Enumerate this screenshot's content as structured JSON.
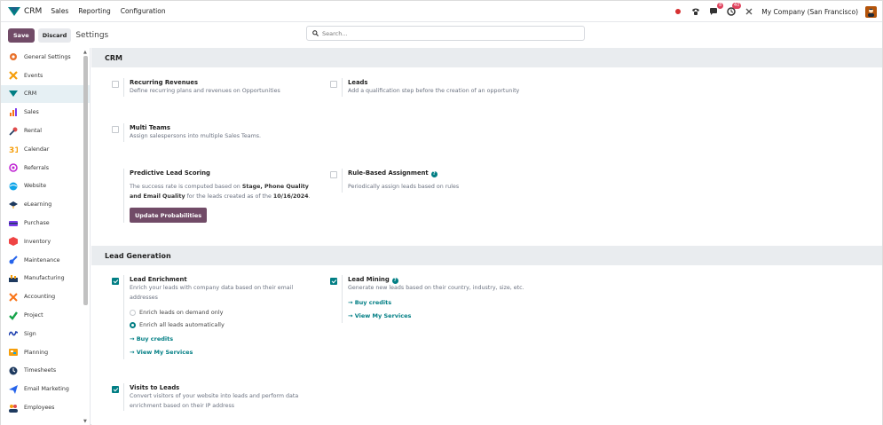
{
  "navbar": {
    "app_name": "CRM",
    "menus": [
      "Sales",
      "Reporting",
      "Configuration"
    ],
    "company": "My Company (San Francisco)",
    "chat_badge": "8",
    "activity_badge": "40",
    "accent": "#714b67"
  },
  "control_panel": {
    "save_label": "Save",
    "discard_label": "Discard",
    "title": "Settings",
    "search_placeholder": "Search..."
  },
  "sidebar": {
    "items": [
      {
        "label": "General Settings",
        "icon": "gear-icon",
        "color": "#e8702a"
      },
      {
        "label": "Events",
        "icon": "events-icon",
        "color": "#f59e0b"
      },
      {
        "label": "CRM",
        "icon": "crm-icon",
        "color": "#017e84"
      },
      {
        "label": "Sales",
        "icon": "sales-icon",
        "color": "#f97316"
      },
      {
        "label": "Rental",
        "icon": "rental-icon",
        "color": "#e14b4b"
      },
      {
        "label": "Calendar",
        "icon": "calendar-icon",
        "color": "#f59e0b"
      },
      {
        "label": "Referrals",
        "icon": "referrals-icon",
        "color": "#c026d3"
      },
      {
        "label": "Website",
        "icon": "website-icon",
        "color": "#0ea5e9"
      },
      {
        "label": "eLearning",
        "icon": "elearning-icon",
        "color": "#1e3a5f"
      },
      {
        "label": "Purchase",
        "icon": "purchase-icon",
        "color": "#7c3aed"
      },
      {
        "label": "Inventory",
        "icon": "inventory-icon",
        "color": "#ef4444"
      },
      {
        "label": "Maintenance",
        "icon": "maintenance-icon",
        "color": "#2563eb"
      },
      {
        "label": "Manufacturing",
        "icon": "manufacturing-icon",
        "color": "#f59e0b"
      },
      {
        "label": "Accounting",
        "icon": "accounting-icon",
        "color": "#f97316"
      },
      {
        "label": "Project",
        "icon": "project-icon",
        "color": "#16a34a"
      },
      {
        "label": "Sign",
        "icon": "sign-icon",
        "color": "#1e40af"
      },
      {
        "label": "Planning",
        "icon": "planning-icon",
        "color": "#f59e0b"
      },
      {
        "label": "Timesheets",
        "icon": "timesheets-icon",
        "color": "#1e3a5f"
      },
      {
        "label": "Email Marketing",
        "icon": "email-marketing-icon",
        "color": "#2563eb"
      },
      {
        "label": "Employees",
        "icon": "employees-icon",
        "color": "#f59e0b"
      }
    ],
    "active_index": 2
  },
  "crm_section": {
    "title": "CRM",
    "recurring": {
      "title": "Recurring Revenues",
      "desc": "Define recurring plans and revenues on Opportunities",
      "checked": false
    },
    "leads": {
      "title": "Leads",
      "desc": "Add a qualification step before the creation of an opportunity",
      "checked": false
    },
    "multi_teams": {
      "title": "Multi Teams",
      "desc": "Assign salespersons into multiple Sales Teams.",
      "checked": false
    },
    "predictive": {
      "title": "Predictive Lead Scoring",
      "desc_a": "The success rate is computed based on ",
      "desc_b": "Stage, Phone Quality",
      "desc_c": "and Email Quality",
      "desc_d": " for the leads created as of the ",
      "desc_e": "10/16/2024",
      "desc_f": ".",
      "button": "Update Probabilities"
    },
    "rule_based": {
      "title": "Rule-Based Assignment",
      "desc": "Periodically assign leads based on rules",
      "checked": false
    }
  },
  "lead_gen_section": {
    "title": "Lead Generation",
    "enrichment": {
      "title": "Lead Enrichment",
      "desc_line1": "Enrich your leads with company data based on their email",
      "desc_line2": "addresses",
      "checked": true,
      "radio_on_demand": "Enrich leads on demand only",
      "radio_auto": "Enrich all leads automatically",
      "selected": "auto",
      "buy_credits": "→ Buy credits",
      "view_services": "→ View My Services"
    },
    "mining": {
      "title": "Lead Mining",
      "desc": "Generate new leads based on their country, industry, size, etc.",
      "checked": true,
      "buy_credits": "→ Buy credits",
      "view_services": "→ View My Services"
    },
    "visits": {
      "title": "Visits to Leads",
      "desc_line1": "Convert visitors of your website into leads and perform data",
      "desc_line2": "enrichment based on their IP address",
      "checked": true
    }
  }
}
